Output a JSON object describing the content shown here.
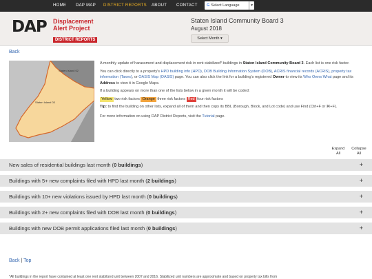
{
  "nav": {
    "items": [
      {
        "label": "HOME",
        "active": false
      },
      {
        "label": "DAP MAP",
        "active": false
      },
      {
        "label": "DISTRICT REPORTS",
        "active": true
      },
      {
        "label": "ABOUT",
        "active": false
      },
      {
        "label": "CONTACT",
        "active": false
      }
    ],
    "language_select": "Select Language",
    "accent_color": "#f0b323"
  },
  "header": {
    "logo_mark": "DAP",
    "logo_line1": "Displacement",
    "logo_line2": "Alert Project",
    "logo_line3": "DISTRICT REPORTS",
    "title": "Staten Island Community Board 3",
    "subtitle": "August 2018",
    "month_button": "Select Month"
  },
  "back_link": "Back",
  "map": {
    "label_other": "Staten Island 02",
    "label_main": "Staten Island 03"
  },
  "intro": {
    "p1_a": "A monthly update of harassment and displacement risk in rent stabilized* buildings in ",
    "p1_district": "Staten Island Community Board 3",
    "p1_b": ". Each list is one risk factor.",
    "p2_a": "You can click directly to a property's ",
    "link_hpd": "HPD building info (HPD)",
    "link_dob": "DOB Building Information System (DOB)",
    "link_acris": "ACRIS financial records (ACRIS)",
    "link_taxes": "property tax information (Taxes)",
    "p2_or": ", or ",
    "link_oasis": "OASIS Map (OASIS)",
    "p2_b": " page. You can also click the link for a building's registered ",
    "p2_owner": "Owner",
    "p2_c": " to view its ",
    "link_wow": "Who Owns What",
    "p2_d": " page and its ",
    "p2_address": "Address",
    "p2_e": " to view it in Google Maps.",
    "p3": "If a building appears on more than one of the lists below in a given month it will be coded:",
    "tag_yellow": "Yellow",
    "tag_yellow_text": " two risk factors ",
    "tag_orange": "Orange",
    "tag_orange_text": " three risk factors ",
    "tag_red": "Red",
    "tag_red_text": " four risk factors",
    "tip_label": "Tip:",
    "tip_text": " to find the building on other lists, expand all of them and then copy its BBL (Borough, Block, and Lot code) and use Find (Ctrl+F or ⌘+F).",
    "p5_a": "For more information on using DAP District Reports, visit the ",
    "link_tutorial": "Tutorial",
    "p5_b": " page.",
    "colors": {
      "yellow": "#f3e36c",
      "orange": "#f2a33c",
      "red": "#e0413b"
    }
  },
  "controls": {
    "expand_line1": "Expand",
    "expand_line2": "All",
    "collapse_line1": "Collapse",
    "collapse_line2": "All"
  },
  "sections": [
    {
      "title": "New sales of residential buildings last month ",
      "count": "0 buildings",
      "toggle": "+"
    },
    {
      "title": "Buildings with 5+ new complaints filed with HPD last month ",
      "count": "2 buildings",
      "toggle": "+"
    },
    {
      "title": "Buildings with 10+ new violations issued by HPD last month ",
      "count": "0 buildings",
      "toggle": "+"
    },
    {
      "title": "Buildings with 2+ new complaints filed with DOB last month ",
      "count": "0 buildings",
      "toggle": "+"
    },
    {
      "title": "Buildings with new DOB permit applications filed last month ",
      "count": "0 buildings",
      "toggle": "+"
    }
  ],
  "footer": {
    "back": "Back",
    "sep": " | ",
    "top": "Top",
    "footnote": "*All buildings in the report have contained at least one rent stabilized unit between 2007 and 2016. Stabilized unit numbers are approximate and based on property tax bills from"
  }
}
